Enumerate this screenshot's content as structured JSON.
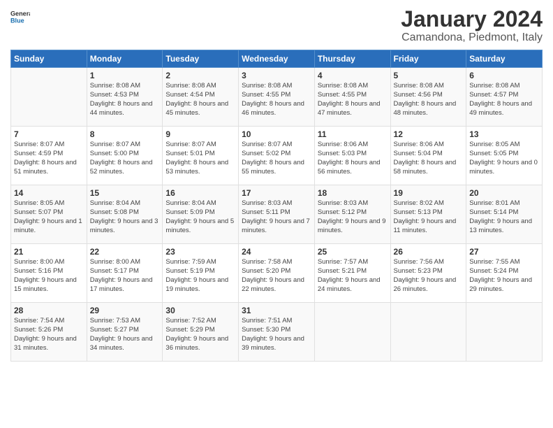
{
  "logo": {
    "general": "General",
    "blue": "Blue"
  },
  "title": "January 2024",
  "subtitle": "Camandona, Piedmont, Italy",
  "days_of_week": [
    "Sunday",
    "Monday",
    "Tuesday",
    "Wednesday",
    "Thursday",
    "Friday",
    "Saturday"
  ],
  "weeks": [
    [
      {
        "date": "",
        "sunrise": "",
        "sunset": "",
        "daylight": ""
      },
      {
        "date": "1",
        "sunrise": "Sunrise: 8:08 AM",
        "sunset": "Sunset: 4:53 PM",
        "daylight": "Daylight: 8 hours and 44 minutes."
      },
      {
        "date": "2",
        "sunrise": "Sunrise: 8:08 AM",
        "sunset": "Sunset: 4:54 PM",
        "daylight": "Daylight: 8 hours and 45 minutes."
      },
      {
        "date": "3",
        "sunrise": "Sunrise: 8:08 AM",
        "sunset": "Sunset: 4:55 PM",
        "daylight": "Daylight: 8 hours and 46 minutes."
      },
      {
        "date": "4",
        "sunrise": "Sunrise: 8:08 AM",
        "sunset": "Sunset: 4:55 PM",
        "daylight": "Daylight: 8 hours and 47 minutes."
      },
      {
        "date": "5",
        "sunrise": "Sunrise: 8:08 AM",
        "sunset": "Sunset: 4:56 PM",
        "daylight": "Daylight: 8 hours and 48 minutes."
      },
      {
        "date": "6",
        "sunrise": "Sunrise: 8:08 AM",
        "sunset": "Sunset: 4:57 PM",
        "daylight": "Daylight: 8 hours and 49 minutes."
      }
    ],
    [
      {
        "date": "7",
        "sunrise": "Sunrise: 8:07 AM",
        "sunset": "Sunset: 4:59 PM",
        "daylight": "Daylight: 8 hours and 51 minutes."
      },
      {
        "date": "8",
        "sunrise": "Sunrise: 8:07 AM",
        "sunset": "Sunset: 5:00 PM",
        "daylight": "Daylight: 8 hours and 52 minutes."
      },
      {
        "date": "9",
        "sunrise": "Sunrise: 8:07 AM",
        "sunset": "Sunset: 5:01 PM",
        "daylight": "Daylight: 8 hours and 53 minutes."
      },
      {
        "date": "10",
        "sunrise": "Sunrise: 8:07 AM",
        "sunset": "Sunset: 5:02 PM",
        "daylight": "Daylight: 8 hours and 55 minutes."
      },
      {
        "date": "11",
        "sunrise": "Sunrise: 8:06 AM",
        "sunset": "Sunset: 5:03 PM",
        "daylight": "Daylight: 8 hours and 56 minutes."
      },
      {
        "date": "12",
        "sunrise": "Sunrise: 8:06 AM",
        "sunset": "Sunset: 5:04 PM",
        "daylight": "Daylight: 8 hours and 58 minutes."
      },
      {
        "date": "13",
        "sunrise": "Sunrise: 8:05 AM",
        "sunset": "Sunset: 5:05 PM",
        "daylight": "Daylight: 9 hours and 0 minutes."
      }
    ],
    [
      {
        "date": "14",
        "sunrise": "Sunrise: 8:05 AM",
        "sunset": "Sunset: 5:07 PM",
        "daylight": "Daylight: 9 hours and 1 minute."
      },
      {
        "date": "15",
        "sunrise": "Sunrise: 8:04 AM",
        "sunset": "Sunset: 5:08 PM",
        "daylight": "Daylight: 9 hours and 3 minutes."
      },
      {
        "date": "16",
        "sunrise": "Sunrise: 8:04 AM",
        "sunset": "Sunset: 5:09 PM",
        "daylight": "Daylight: 9 hours and 5 minutes."
      },
      {
        "date": "17",
        "sunrise": "Sunrise: 8:03 AM",
        "sunset": "Sunset: 5:11 PM",
        "daylight": "Daylight: 9 hours and 7 minutes."
      },
      {
        "date": "18",
        "sunrise": "Sunrise: 8:03 AM",
        "sunset": "Sunset: 5:12 PM",
        "daylight": "Daylight: 9 hours and 9 minutes."
      },
      {
        "date": "19",
        "sunrise": "Sunrise: 8:02 AM",
        "sunset": "Sunset: 5:13 PM",
        "daylight": "Daylight: 9 hours and 11 minutes."
      },
      {
        "date": "20",
        "sunrise": "Sunrise: 8:01 AM",
        "sunset": "Sunset: 5:14 PM",
        "daylight": "Daylight: 9 hours and 13 minutes."
      }
    ],
    [
      {
        "date": "21",
        "sunrise": "Sunrise: 8:00 AM",
        "sunset": "Sunset: 5:16 PM",
        "daylight": "Daylight: 9 hours and 15 minutes."
      },
      {
        "date": "22",
        "sunrise": "Sunrise: 8:00 AM",
        "sunset": "Sunset: 5:17 PM",
        "daylight": "Daylight: 9 hours and 17 minutes."
      },
      {
        "date": "23",
        "sunrise": "Sunrise: 7:59 AM",
        "sunset": "Sunset: 5:19 PM",
        "daylight": "Daylight: 9 hours and 19 minutes."
      },
      {
        "date": "24",
        "sunrise": "Sunrise: 7:58 AM",
        "sunset": "Sunset: 5:20 PM",
        "daylight": "Daylight: 9 hours and 22 minutes."
      },
      {
        "date": "25",
        "sunrise": "Sunrise: 7:57 AM",
        "sunset": "Sunset: 5:21 PM",
        "daylight": "Daylight: 9 hours and 24 minutes."
      },
      {
        "date": "26",
        "sunrise": "Sunrise: 7:56 AM",
        "sunset": "Sunset: 5:23 PM",
        "daylight": "Daylight: 9 hours and 26 minutes."
      },
      {
        "date": "27",
        "sunrise": "Sunrise: 7:55 AM",
        "sunset": "Sunset: 5:24 PM",
        "daylight": "Daylight: 9 hours and 29 minutes."
      }
    ],
    [
      {
        "date": "28",
        "sunrise": "Sunrise: 7:54 AM",
        "sunset": "Sunset: 5:26 PM",
        "daylight": "Daylight: 9 hours and 31 minutes."
      },
      {
        "date": "29",
        "sunrise": "Sunrise: 7:53 AM",
        "sunset": "Sunset: 5:27 PM",
        "daylight": "Daylight: 9 hours and 34 minutes."
      },
      {
        "date": "30",
        "sunrise": "Sunrise: 7:52 AM",
        "sunset": "Sunset: 5:29 PM",
        "daylight": "Daylight: 9 hours and 36 minutes."
      },
      {
        "date": "31",
        "sunrise": "Sunrise: 7:51 AM",
        "sunset": "Sunset: 5:30 PM",
        "daylight": "Daylight: 9 hours and 39 minutes."
      },
      {
        "date": "",
        "sunrise": "",
        "sunset": "",
        "daylight": ""
      },
      {
        "date": "",
        "sunrise": "",
        "sunset": "",
        "daylight": ""
      },
      {
        "date": "",
        "sunrise": "",
        "sunset": "",
        "daylight": ""
      }
    ]
  ]
}
